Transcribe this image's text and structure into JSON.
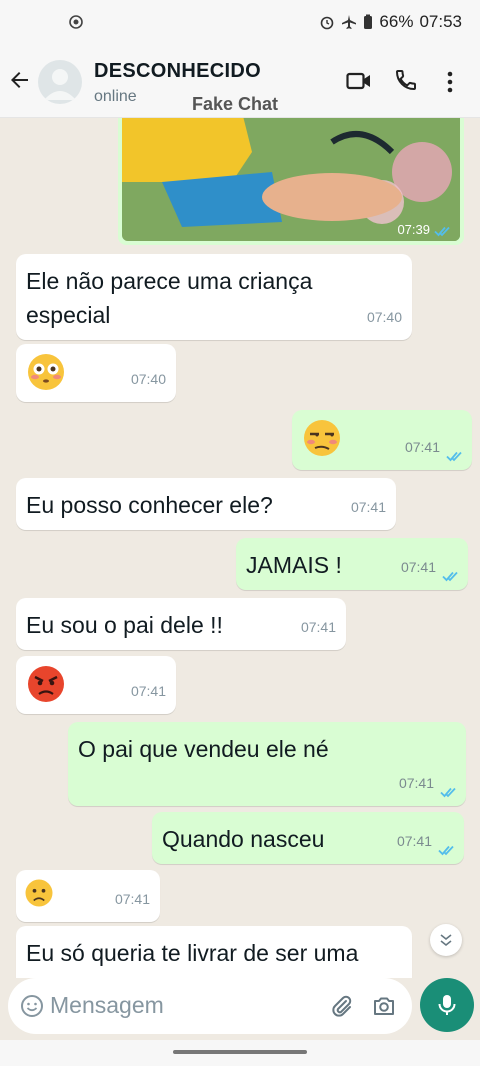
{
  "status_bar": {
    "battery": "66%",
    "time": "07:53"
  },
  "header": {
    "contact_name": "DESCONHECIDO",
    "contact_status": "online",
    "watermark": "Fake Chat"
  },
  "image_message": {
    "time": "07:39"
  },
  "messages": [
    {
      "direction": "in",
      "text_line1": "Ele não parece uma criança",
      "text_line2": "especial",
      "time": "07:40"
    },
    {
      "direction": "in",
      "emoji": "flushed-face",
      "time": "07:40"
    },
    {
      "direction": "out",
      "emoji": "unamused-face",
      "time": "07:41"
    },
    {
      "direction": "in",
      "text": "Eu posso conhecer ele?",
      "time": "07:41"
    },
    {
      "direction": "out",
      "text": "JAMAIS !",
      "time": "07:41"
    },
    {
      "direction": "in",
      "text": "Eu sou o pai dele !!",
      "time": "07:41"
    },
    {
      "direction": "in",
      "emoji": "angry-face",
      "time": "07:41"
    },
    {
      "direction": "out",
      "text": "O pai que vendeu ele né",
      "time": "07:41"
    },
    {
      "direction": "out",
      "text": "Quando nasceu",
      "time": "07:41"
    },
    {
      "direction": "in",
      "emoji": "frowning-face",
      "time": "07:41"
    },
    {
      "direction": "in",
      "text": "Eu só queria te livrar de ser uma"
    }
  ],
  "input": {
    "placeholder": "Mensagem"
  },
  "colors": {
    "outgoing": "#d9fdd3",
    "incoming": "#ffffff",
    "accent": "#1a8e77",
    "read_ticks": "#53bdeb"
  }
}
